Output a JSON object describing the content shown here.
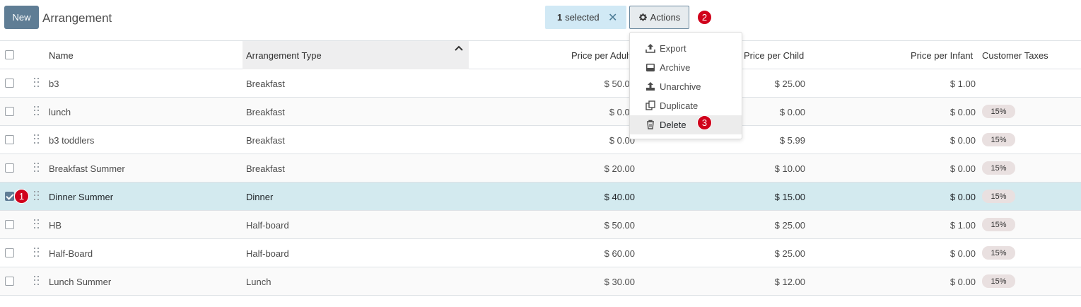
{
  "toolbar": {
    "new_label": "New",
    "title": "Arrangement",
    "selected_count": "1",
    "selected_label": "selected",
    "actions_label": "Actions"
  },
  "badges": {
    "b1": "1",
    "b2": "2",
    "b3": "3"
  },
  "columns": {
    "name": "Name",
    "type": "Arrangement Type",
    "adult": "Price per Adult",
    "child": "Price per Child",
    "infant": "Price per Infant",
    "taxes": "Customer Taxes"
  },
  "rows": [
    {
      "name": "b3",
      "type": "Breakfast",
      "adult": "$ 50.00",
      "child": "$ 25.00",
      "infant": "$ 1.00",
      "tax": ""
    },
    {
      "name": "lunch",
      "type": "Breakfast",
      "adult": "$ 0.00",
      "child": "$ 0.00",
      "infant": "$ 0.00",
      "tax": "15%"
    },
    {
      "name": "b3 toddlers",
      "type": "Breakfast",
      "adult": "$ 0.00",
      "child": "$ 5.99",
      "infant": "$ 0.00",
      "tax": "15%"
    },
    {
      "name": "Breakfast Summer",
      "type": "Breakfast",
      "adult": "$ 20.00",
      "child": "$ 10.00",
      "infant": "$ 0.00",
      "tax": "15%"
    },
    {
      "name": "Dinner Summer",
      "type": "Dinner",
      "adult": "$ 40.00",
      "child": "$ 15.00",
      "infant": "$ 0.00",
      "tax": "15%"
    },
    {
      "name": "HB",
      "type": "Half-board",
      "adult": "$ 50.00",
      "child": "$ 25.00",
      "infant": "$ 1.00",
      "tax": "15%"
    },
    {
      "name": "Half-Board",
      "type": "Half-board",
      "adult": "$ 60.00",
      "child": "$ 25.00",
      "infant": "$ 0.00",
      "tax": "15%"
    },
    {
      "name": "Lunch Summer",
      "type": "Lunch",
      "adult": "$ 30.00",
      "child": "$ 12.00",
      "infant": "$ 0.00",
      "tax": "15%"
    }
  ],
  "menu": {
    "export": "Export",
    "archive": "Archive",
    "unarchive": "Unarchive",
    "duplicate": "Duplicate",
    "delete": "Delete"
  }
}
